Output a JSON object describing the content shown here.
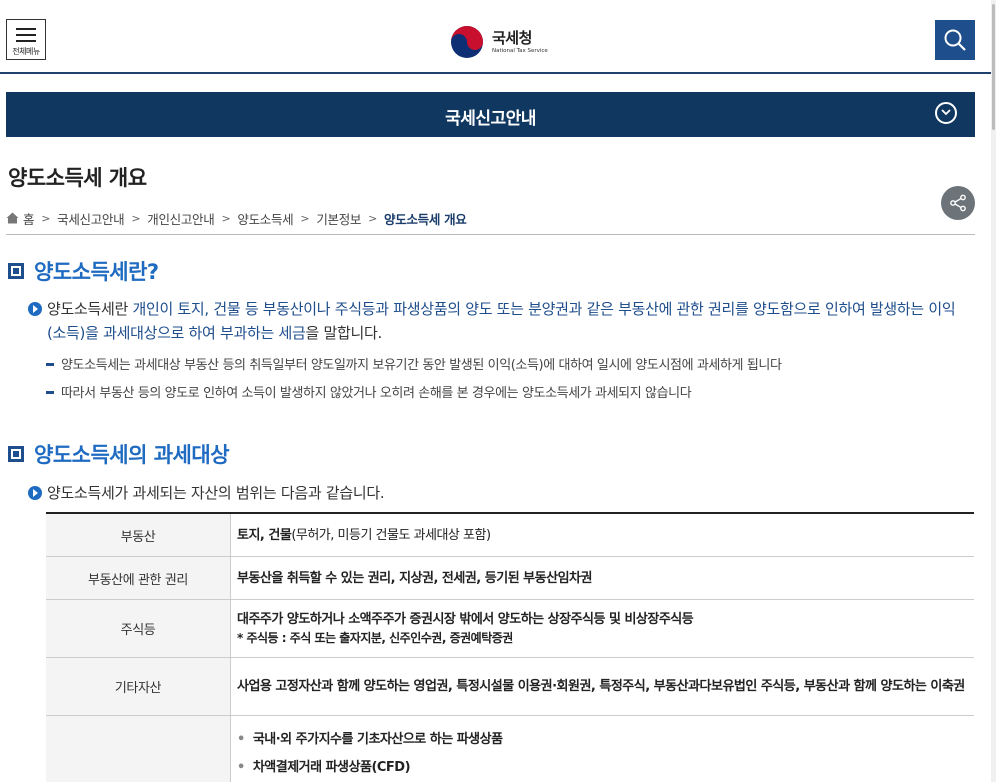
{
  "header": {
    "menu_label": "전체메뉴",
    "logo_kor": "국세청",
    "logo_eng": "National Tax Service",
    "search_icon": "search-icon",
    "accent": "#1f4e8c"
  },
  "banner": {
    "title": "국세신고안내",
    "bg": "#0f3760"
  },
  "page": {
    "title": "양도소득세 개요"
  },
  "breadcrumb": {
    "items": [
      "홈",
      "국세신고안내",
      "개인신고안내",
      "양도소득세",
      "기본정보"
    ],
    "current": "양도소득세 개요"
  },
  "section1": {
    "heading": "양도소득세란?",
    "lead_prefix": "양도소득세란 ",
    "lead_hl": "개인이 토지, 건물 등 부동산이나 주식등과 파생상품의 양도 또는 분양권과 같은 부동산에 관한 권리를 양도함으로 인하여 발생하는 이익(소득)을 과세대상으로 하여 부과하는 세금",
    "lead_suffix": "을 말합니다.",
    "points": [
      "양도소득세는 과세대상 부동산 등의 취득일부터 양도일까지 보유기간 동안 발생된 이익(소득)에 대하여 일시에 양도시점에 과세하게 됩니다",
      "따라서 부동산 등의 양도로 인하여 소득이 발생하지 않았거나 오히려 손해를 본 경우에는 양도소득세가 과세되지 않습니다"
    ]
  },
  "section2": {
    "heading": "양도소득세의 과세대상",
    "lead": "양도소득세가 과세되는 자산의 범위는 다음과 같습니다.",
    "table": [
      {
        "label": "부동산",
        "bold": "토지, 건물",
        "rest": "(무허가, 미등기 건물도 과세대상 포함)"
      },
      {
        "label": "부동산에 관한 권리",
        "bold": "부동산을 취득할 수 있는 권리, 지상권, 전세권, 등기된 부동산임차권",
        "rest": ""
      },
      {
        "label": "주식등",
        "bold": "대주주가 양도하거나 소액주주가 증권시장 밖에서 양도하는 상장주식등 및 비상장주식등",
        "note": "* 주식등 : 주식 또는 출자지분, 신주인수권, 증권예탁증권"
      },
      {
        "label": "기타자산",
        "bold": "사업용 고정자산과 함께 양도하는 영업권, 특정시설물 이용권·회원권, 특정주식, 부동산과다보유법인 주식등, 부동산과 함께 양도하는 이축권",
        "rest": ""
      },
      {
        "label": "",
        "items": [
          "국내·외 주가지수를 기초자산으로 하는 파생상품",
          "차액결제거래 파생상품(CFD)"
        ]
      }
    ]
  }
}
